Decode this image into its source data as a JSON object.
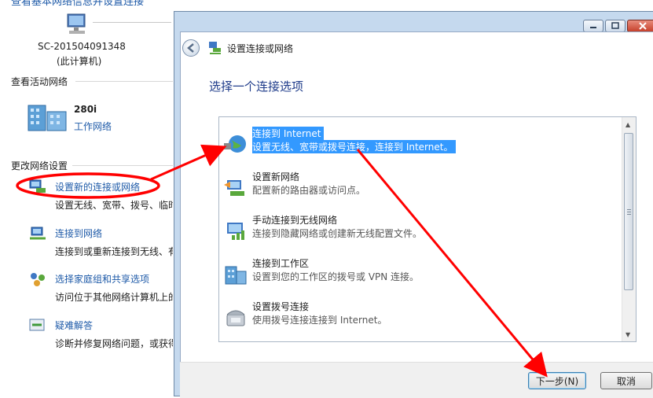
{
  "background": {
    "title": "查看基本网络信息并设置连接",
    "computer": {
      "name": "SC-201504091348",
      "sub": "(此计算机)"
    },
    "active_label": "查看活动网络",
    "network": {
      "name": "280i",
      "type": "工作网络"
    },
    "change_label": "更改网络设置",
    "items": [
      {
        "link": "设置新的连接或网络",
        "desc": "设置无线、宽带、拨号、临时"
      },
      {
        "link": "连接到网络",
        "desc": "连接到或重新连接到无线、有"
      },
      {
        "link": "选择家庭组和共享选项",
        "desc": "访问位于其他网络计算机上的"
      },
      {
        "link": "疑难解答",
        "desc": "诊断并修复网络问题，或获得"
      }
    ]
  },
  "dialog": {
    "title": "设置连接或网络",
    "heading": "选择一个连接选项",
    "options": [
      {
        "title": "连接到 Internet",
        "desc": "设置无线、宽带或拨号连接，连接到 Internet。"
      },
      {
        "title": "设置新网络",
        "desc": "配置新的路由器或访问点。"
      },
      {
        "title": "手动连接到无线网络",
        "desc": "连接到隐藏网络或创建新无线配置文件。"
      },
      {
        "title": "连接到工作区",
        "desc": "设置到您的工作区的拨号或 VPN 连接。"
      },
      {
        "title": "设置拨号连接",
        "desc": "使用拨号连接连接到 Internet。"
      }
    ],
    "next_label": "下一步(N)",
    "cancel_label": "取消"
  },
  "colors": {
    "link": "#1e5aa8",
    "selection": "#3399ff",
    "annotation": "#ff0000"
  }
}
